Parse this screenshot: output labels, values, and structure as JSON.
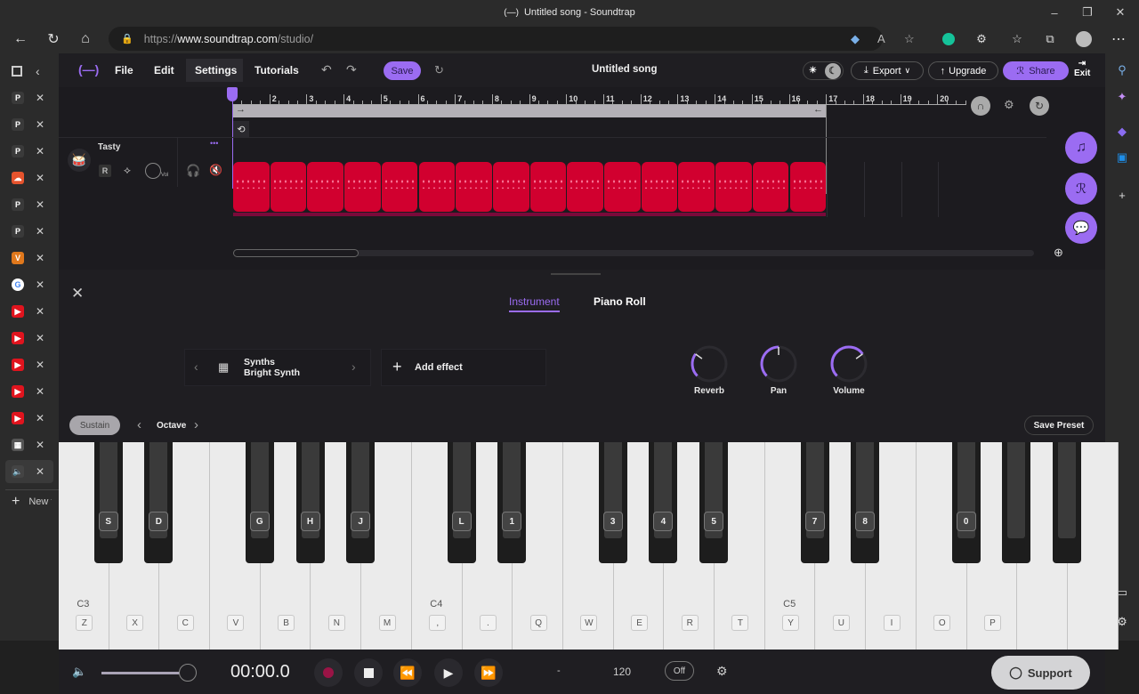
{
  "browser": {
    "window_title": "Untitled song - Soundtrap",
    "url_scheme": "https://",
    "url_host": "www.soundtrap.com",
    "url_path": "/studio/",
    "controls": {
      "minimize": "–",
      "maximize": "❐",
      "close": "✕"
    },
    "nav": {
      "back": "←",
      "refresh": "↻",
      "home": "⌂"
    },
    "new_tab_label": "New tab",
    "vertical_tabs": [
      {
        "icon": "pinterest-icon",
        "glyph": "P",
        "color": "#3a3a3a"
      },
      {
        "icon": "pinterest-icon",
        "glyph": "P",
        "color": "#3a3a3a"
      },
      {
        "icon": "pinterest-icon",
        "glyph": "P",
        "color": "#3a3a3a"
      },
      {
        "icon": "soundcloud-icon",
        "glyph": "☁",
        "color": "#e5532d"
      },
      {
        "icon": "pinterest-icon",
        "glyph": "P",
        "color": "#3a3a3a"
      },
      {
        "icon": "pinterest-icon",
        "glyph": "P",
        "color": "#3a3a3a"
      },
      {
        "icon": "vivaldi-icon",
        "glyph": "V",
        "color": "#e0781c"
      },
      {
        "icon": "google-icon",
        "glyph": "G",
        "color": "#ffffff"
      },
      {
        "icon": "youtube-icon",
        "glyph": "▶",
        "color": "#e0141e"
      },
      {
        "icon": "youtube-icon",
        "glyph": "▶",
        "color": "#e0141e"
      },
      {
        "icon": "youtube-icon",
        "glyph": "▶",
        "color": "#e0141e"
      },
      {
        "icon": "youtube-icon",
        "glyph": "▶",
        "color": "#e0141e"
      },
      {
        "icon": "youtube-icon",
        "glyph": "▶",
        "color": "#e0141e"
      },
      {
        "icon": "calculator-icon",
        "glyph": "▦",
        "color": "#555555"
      },
      {
        "icon": "speaker-icon",
        "glyph": "🔈",
        "color": "#444444"
      }
    ]
  },
  "app": {
    "menu": [
      "File",
      "Edit",
      "Settings",
      "Tutorials"
    ],
    "save_label": "Save",
    "song_title": "Untitled song",
    "export_label": "Export",
    "upgrade_label": "Upgrade",
    "share_label": "Share",
    "exit_label": "Exit",
    "accent_color": "#9b6cf2",
    "region_color": "#d1002f"
  },
  "timeline": {
    "bar_numbers": [
      "2",
      "3",
      "4",
      "5",
      "6",
      "7",
      "8",
      "9",
      "10",
      "11",
      "12",
      "13",
      "14",
      "15",
      "16",
      "17",
      "18",
      "19",
      "20"
    ],
    "loop_start_bar": 1,
    "loop_end_bar": 17,
    "region_count": 16
  },
  "track": {
    "name": "Tasty",
    "record_label": "R",
    "vol_label": "Vol",
    "more_label": "•••"
  },
  "editor": {
    "tabs": [
      {
        "label": "Instrument",
        "active": true
      },
      {
        "label": "Piano Roll",
        "active": false
      }
    ],
    "instrument_category": "Synths",
    "instrument_name": "Bright Synth",
    "add_effect_label": "Add effect",
    "knobs": [
      {
        "label": "Reverb",
        "value": 0.3
      },
      {
        "label": "Pan",
        "value": 0.5
      },
      {
        "label": "Volume",
        "value": 0.7
      }
    ],
    "sustain_label": "Sustain",
    "octave_label": "Octave",
    "save_preset_label": "Save Preset"
  },
  "piano": {
    "white_keys": [
      "Z",
      "X",
      "C",
      "V",
      "B",
      "N",
      "M",
      ",",
      ".",
      "Q",
      "W",
      "E",
      "R",
      "T",
      "Y",
      "U",
      "I",
      "O",
      "P",
      "",
      ""
    ],
    "octave_labels": [
      {
        "label": "C3",
        "index": 0
      },
      {
        "label": "C4",
        "index": 7
      },
      {
        "label": "C5",
        "index": 14
      }
    ],
    "black_keys": [
      {
        "after": 0,
        "label": "S"
      },
      {
        "after": 1,
        "label": "D"
      },
      {
        "after": 3,
        "label": "G"
      },
      {
        "after": 4,
        "label": "H"
      },
      {
        "after": 5,
        "label": "J"
      },
      {
        "after": 7,
        "label": "L"
      },
      {
        "after": 8,
        "label": "1"
      },
      {
        "after": 10,
        "label": "3"
      },
      {
        "after": 11,
        "label": "4"
      },
      {
        "after": 12,
        "label": "5"
      },
      {
        "after": 14,
        "label": "7"
      },
      {
        "after": 15,
        "label": "8"
      },
      {
        "after": 17,
        "label": "0"
      },
      {
        "after": 18,
        "label": ""
      },
      {
        "after": 19,
        "label": ""
      }
    ]
  },
  "transport": {
    "time": "00:00.0",
    "key": "-",
    "tempo": "120",
    "metronome": "Off",
    "master_volume": 0.9,
    "support_label": "Support"
  }
}
